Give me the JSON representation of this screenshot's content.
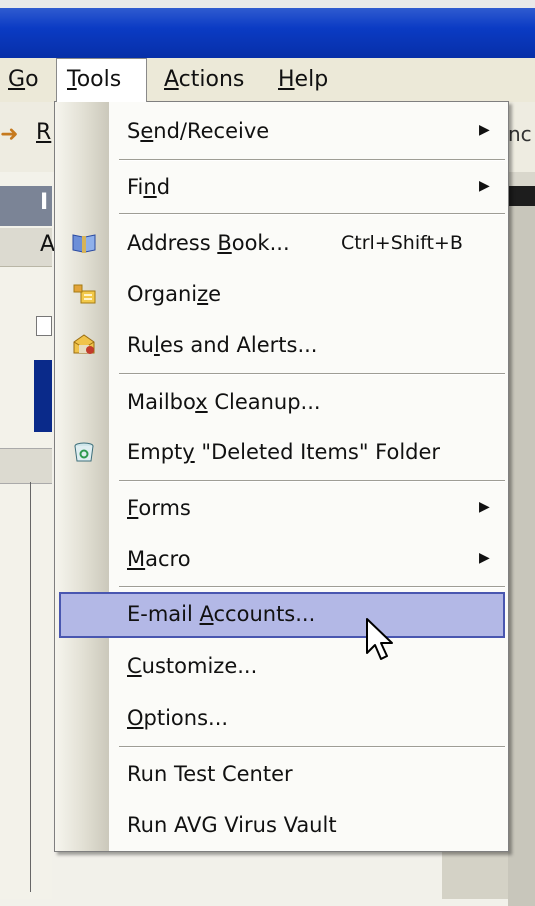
{
  "menubar": {
    "items": [
      {
        "pre": "",
        "u": "G",
        "post": "o"
      },
      {
        "pre": "",
        "u": "T",
        "post": "ools"
      },
      {
        "pre": "",
        "u": "A",
        "post": "ctions"
      },
      {
        "pre": "",
        "u": "H",
        "post": "elp"
      }
    ]
  },
  "toolbar": {
    "r_letter": "R",
    "clipped_text": "nc"
  },
  "left_pane": {
    "item1": "I",
    "item2": "A"
  },
  "tools_menu": {
    "items": [
      {
        "pre": "S",
        "u": "e",
        "post": "nd/Receive",
        "shortcut": "",
        "submenu": true
      },
      {
        "pre": "Fi",
        "u": "n",
        "post": "d",
        "shortcut": "",
        "submenu": true
      },
      {
        "pre": "Address ",
        "u": "B",
        "post": "ook...",
        "shortcut": "Ctrl+Shift+B",
        "submenu": false
      },
      {
        "pre": "Organi",
        "u": "z",
        "post": "e",
        "shortcut": "",
        "submenu": false
      },
      {
        "pre": "Ru",
        "u": "l",
        "post": "es and Alerts...",
        "shortcut": "",
        "submenu": false
      },
      {
        "pre": "Mailbo",
        "u": "x",
        "post": " Cleanup...",
        "shortcut": "",
        "submenu": false
      },
      {
        "pre": "Empt",
        "u": "y",
        "post": " \"Deleted Items\" Folder",
        "shortcut": "",
        "submenu": false
      },
      {
        "pre": "",
        "u": "F",
        "post": "orms",
        "shortcut": "",
        "submenu": true
      },
      {
        "pre": "",
        "u": "M",
        "post": "acro",
        "shortcut": "",
        "submenu": true
      },
      {
        "pre": "E-mail ",
        "u": "A",
        "post": "ccounts...",
        "shortcut": "",
        "submenu": false,
        "highlighted": true
      },
      {
        "pre": "",
        "u": "C",
        "post": "ustomize...",
        "shortcut": "",
        "submenu": false
      },
      {
        "pre": "",
        "u": "O",
        "post": "ptions...",
        "shortcut": "",
        "submenu": false
      },
      {
        "pre": "Run Test Center",
        "u": "",
        "post": "",
        "shortcut": "",
        "submenu": false
      },
      {
        "pre": "Run AVG Virus Vault",
        "u": "",
        "post": "",
        "shortcut": "",
        "submenu": false
      }
    ]
  },
  "icons": {
    "address_book": "address-book-icon",
    "organize": "organize-icon",
    "rules": "rules-alerts-icon",
    "recycle": "recycle-bin-icon"
  },
  "colors": {
    "highlight_fill": "#b3b8e6",
    "highlight_border": "#4956b0",
    "titlebar": "#0b3bc4"
  }
}
